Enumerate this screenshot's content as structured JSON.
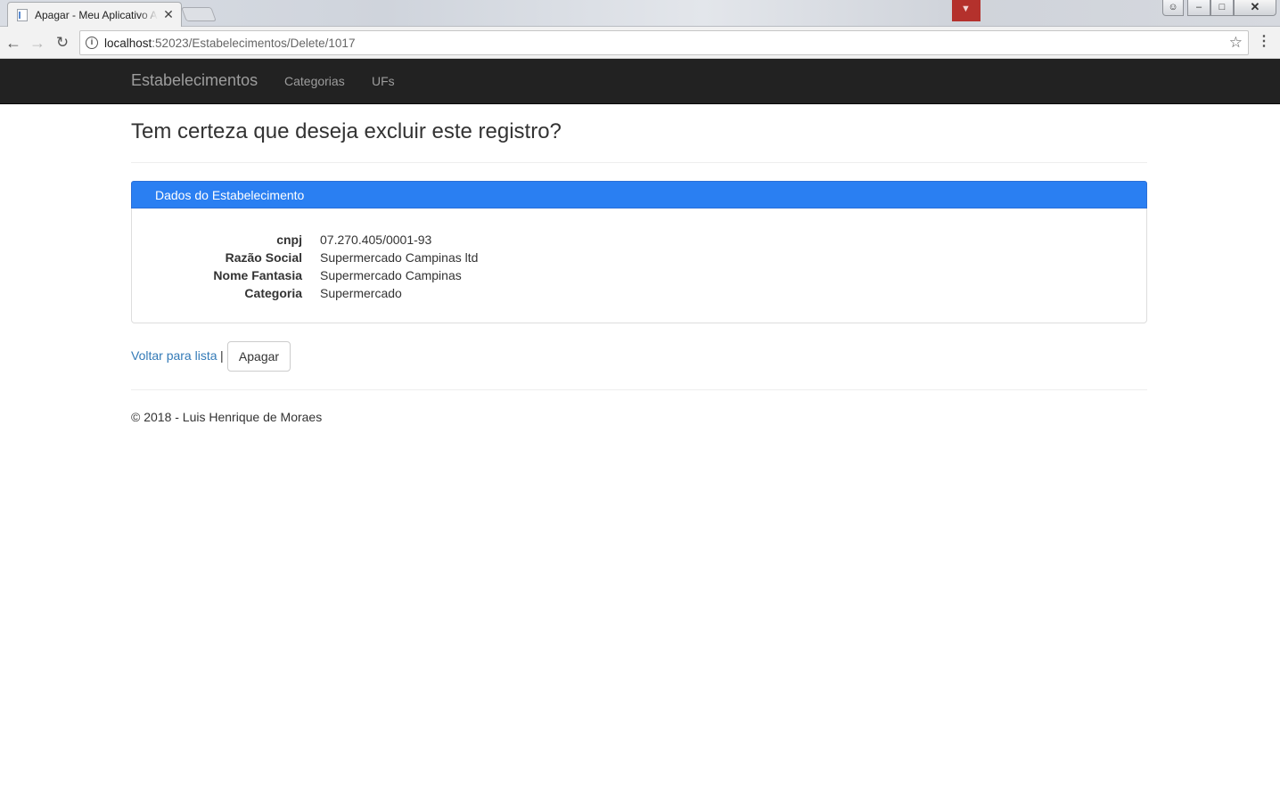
{
  "browser": {
    "tab_title": "Apagar - Meu Aplicativo ASP.NET",
    "tab_close": "✕",
    "url_host": "localhost",
    "url_rest": ":52023/Estabelecimentos/Delete/1017",
    "icons": {
      "back": "arrow-left-icon",
      "forward": "arrow-right-icon",
      "reload": "reload-icon",
      "info": "info-icon",
      "star": "star-icon",
      "menu": "menu-dots-icon"
    }
  },
  "navbar": {
    "brand": "Estabelecimentos",
    "links": [
      "Categorias",
      "UFs"
    ]
  },
  "main": {
    "title": "Tem certeza que deseja excluir este registro?",
    "panel": {
      "heading": "Dados do Estabelecimento",
      "fields": [
        {
          "label": "cnpj",
          "value": "07.270.405/0001-93"
        },
        {
          "label": "Razão Social",
          "value": "Supermercado Campinas ltd"
        },
        {
          "label": "Nome Fantasia",
          "value": "Supermercado Campinas"
        },
        {
          "label": "Categoria",
          "value": "Supermercado"
        }
      ]
    },
    "back_link": "Voltar para lista",
    "separator": "|",
    "delete_button": "Apagar"
  },
  "footer": {
    "text": "© 2018 - Luis Henrique de Moraes"
  },
  "colors": {
    "navbar_bg": "#222222",
    "panel_heading_bg": "#2a7ff2",
    "link": "#337ab7"
  }
}
